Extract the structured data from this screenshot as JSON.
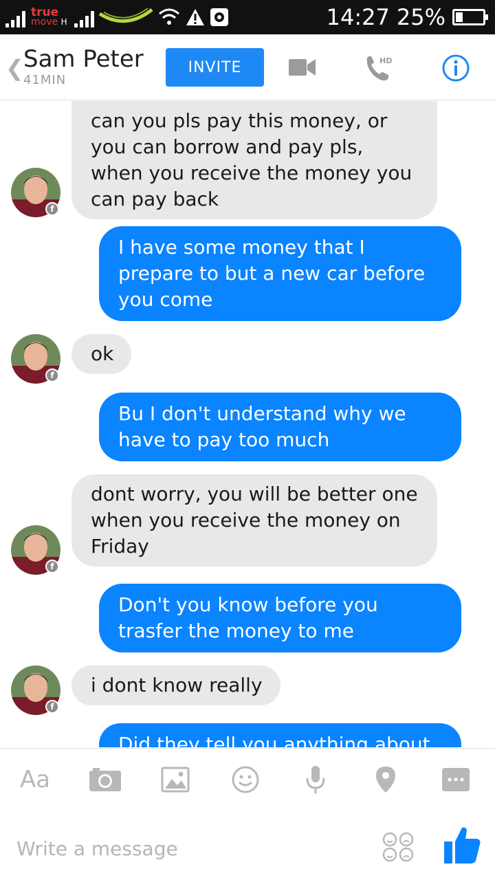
{
  "status_bar": {
    "carrier_line1": "true",
    "carrier_line2": "move",
    "network_type": "H",
    "time": "14:27",
    "battery": "25%",
    "battery_level": 0.25
  },
  "header": {
    "name": "Sam Peter",
    "active": "41MIN",
    "invite_label": "INVITE",
    "hd_label": "HD",
    "accent": "#1e88f5"
  },
  "messages": [
    {
      "from": "them",
      "text": "can you pls pay this money, or you can borrow and pay pls, when you receive the money you can pay back"
    },
    {
      "from": "me",
      "text": "I have some money that I prepare to but a new car before you come"
    },
    {
      "from": "them",
      "text": "ok"
    },
    {
      "from": "me",
      "text": "Bu I don't understand why we have to pay too much"
    },
    {
      "from": "them",
      "text": "dont worry, you will be better one when you receive the money on Friday"
    },
    {
      "from": "me",
      "text": "Don't you know before you trasfer the money to me"
    },
    {
      "from": "them",
      "text": "i dont know really"
    },
    {
      "from": "me",
      "text": "Did they tell you anything about"
    }
  ],
  "toolbar": {
    "text_label": "Aa",
    "icons": [
      "text-format-icon",
      "camera-icon",
      "gallery-icon",
      "emoji-icon",
      "microphone-icon",
      "location-icon",
      "more-icon"
    ]
  },
  "compose": {
    "placeholder": "Write a message"
  }
}
